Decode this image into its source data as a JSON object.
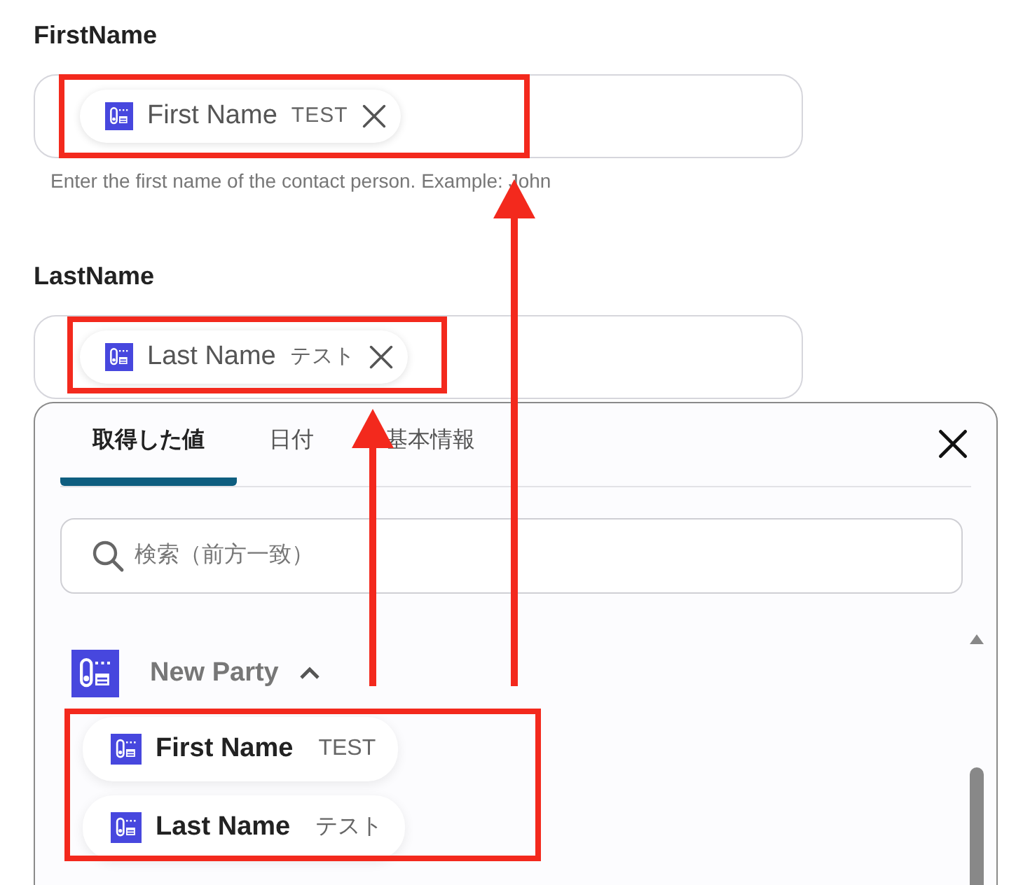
{
  "fields": [
    {
      "label": "FirstName",
      "chip": {
        "name": "First Name",
        "value": "TEST"
      },
      "help": "Enter the first name of the contact person. Example: John"
    },
    {
      "label": "LastName",
      "chip": {
        "name": "Last Name",
        "value": "テスト"
      }
    }
  ],
  "picker": {
    "tabs": [
      {
        "label": "取得した値",
        "selected": true
      },
      {
        "label": "日付",
        "selected": false
      },
      {
        "label": "基本情報",
        "selected": false
      }
    ],
    "search": {
      "placeholder": "検索（前方一致）"
    },
    "group": {
      "name": "New Party",
      "expanded": true
    },
    "items": [
      {
        "name": "First Name",
        "value": "TEST"
      },
      {
        "name": "Last Name",
        "value": "テスト"
      }
    ]
  }
}
